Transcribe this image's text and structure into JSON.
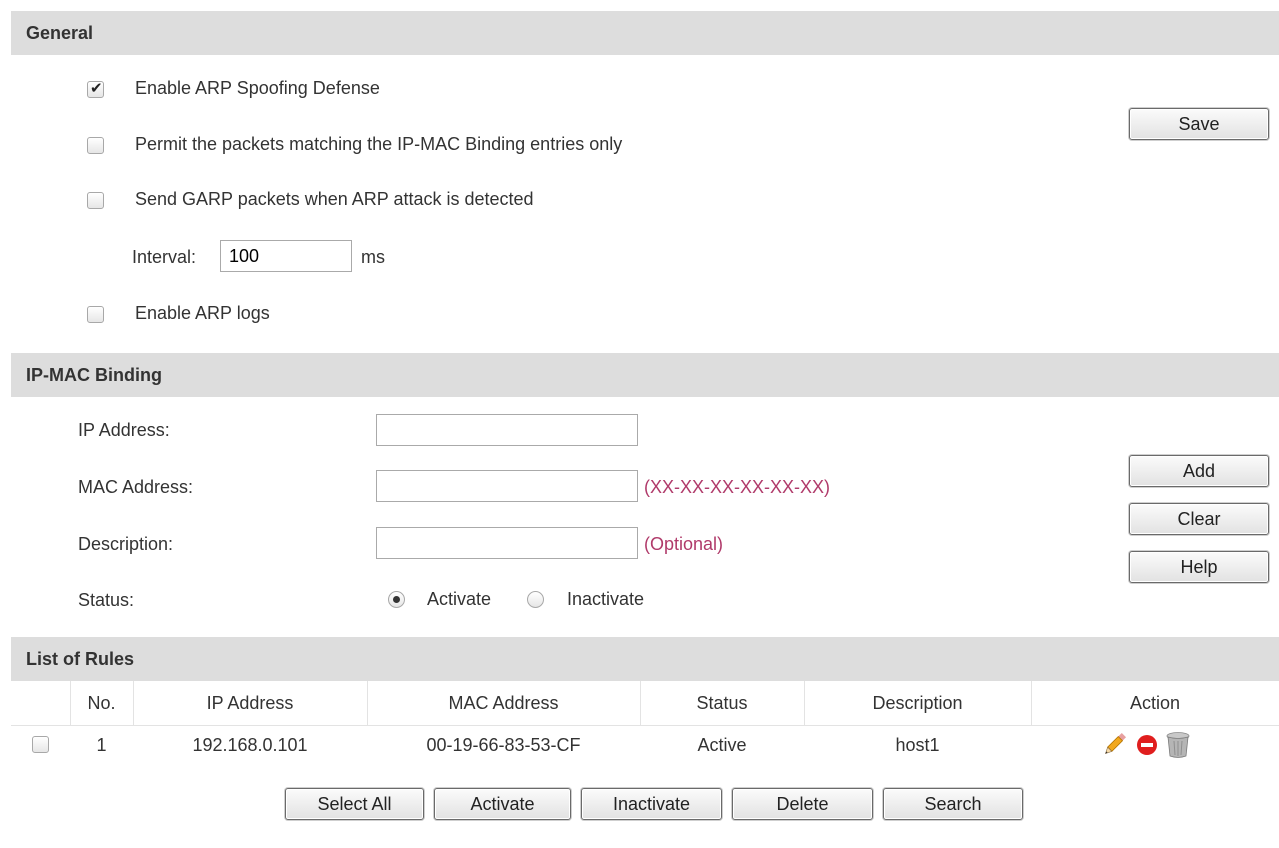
{
  "general": {
    "title": "General",
    "enable_arp_spoofing": {
      "label": "Enable ARP Spoofing Defense",
      "checked": true
    },
    "permit_ipmac_only": {
      "label": "Permit the packets matching the IP-MAC Binding entries only",
      "checked": false
    },
    "send_garp": {
      "label": "Send GARP packets when ARP attack is detected",
      "checked": false
    },
    "interval": {
      "label": "Interval:",
      "value": "100",
      "unit": "ms"
    },
    "enable_arp_logs": {
      "label": "Enable ARP logs",
      "checked": false
    },
    "save_label": "Save"
  },
  "ipmac": {
    "title": "IP-MAC Binding",
    "ip_label": "IP Address:",
    "ip_value": "",
    "mac_label": "MAC Address:",
    "mac_value": "",
    "mac_hint": "(XX-XX-XX-XX-XX-XX)",
    "desc_label": "Description:",
    "desc_value": "",
    "desc_hint": "(Optional)",
    "status_label": "Status:",
    "status_options": [
      "Activate",
      "Inactivate"
    ],
    "status_selected": "Activate",
    "add_label": "Add",
    "clear_label": "Clear",
    "help_label": "Help"
  },
  "rules": {
    "title": "List of Rules",
    "columns": [
      "No.",
      "IP Address",
      "MAC Address",
      "Status",
      "Description",
      "Action"
    ],
    "rows": [
      {
        "no": "1",
        "ip": "192.168.0.101",
        "mac": "00-19-66-83-53-CF",
        "status": "Active",
        "description": "host1",
        "actions": [
          "pencil-edit-icon",
          "red-disable-icon",
          "trash-bin-icon"
        ]
      }
    ],
    "buttons": {
      "select_all": "Select All",
      "activate": "Activate",
      "inactivate": "Inactivate",
      "delete": "Delete",
      "search": "Search"
    }
  },
  "colors": {
    "header_bg": "#dddddd",
    "hint_text": "#b03a6a"
  }
}
